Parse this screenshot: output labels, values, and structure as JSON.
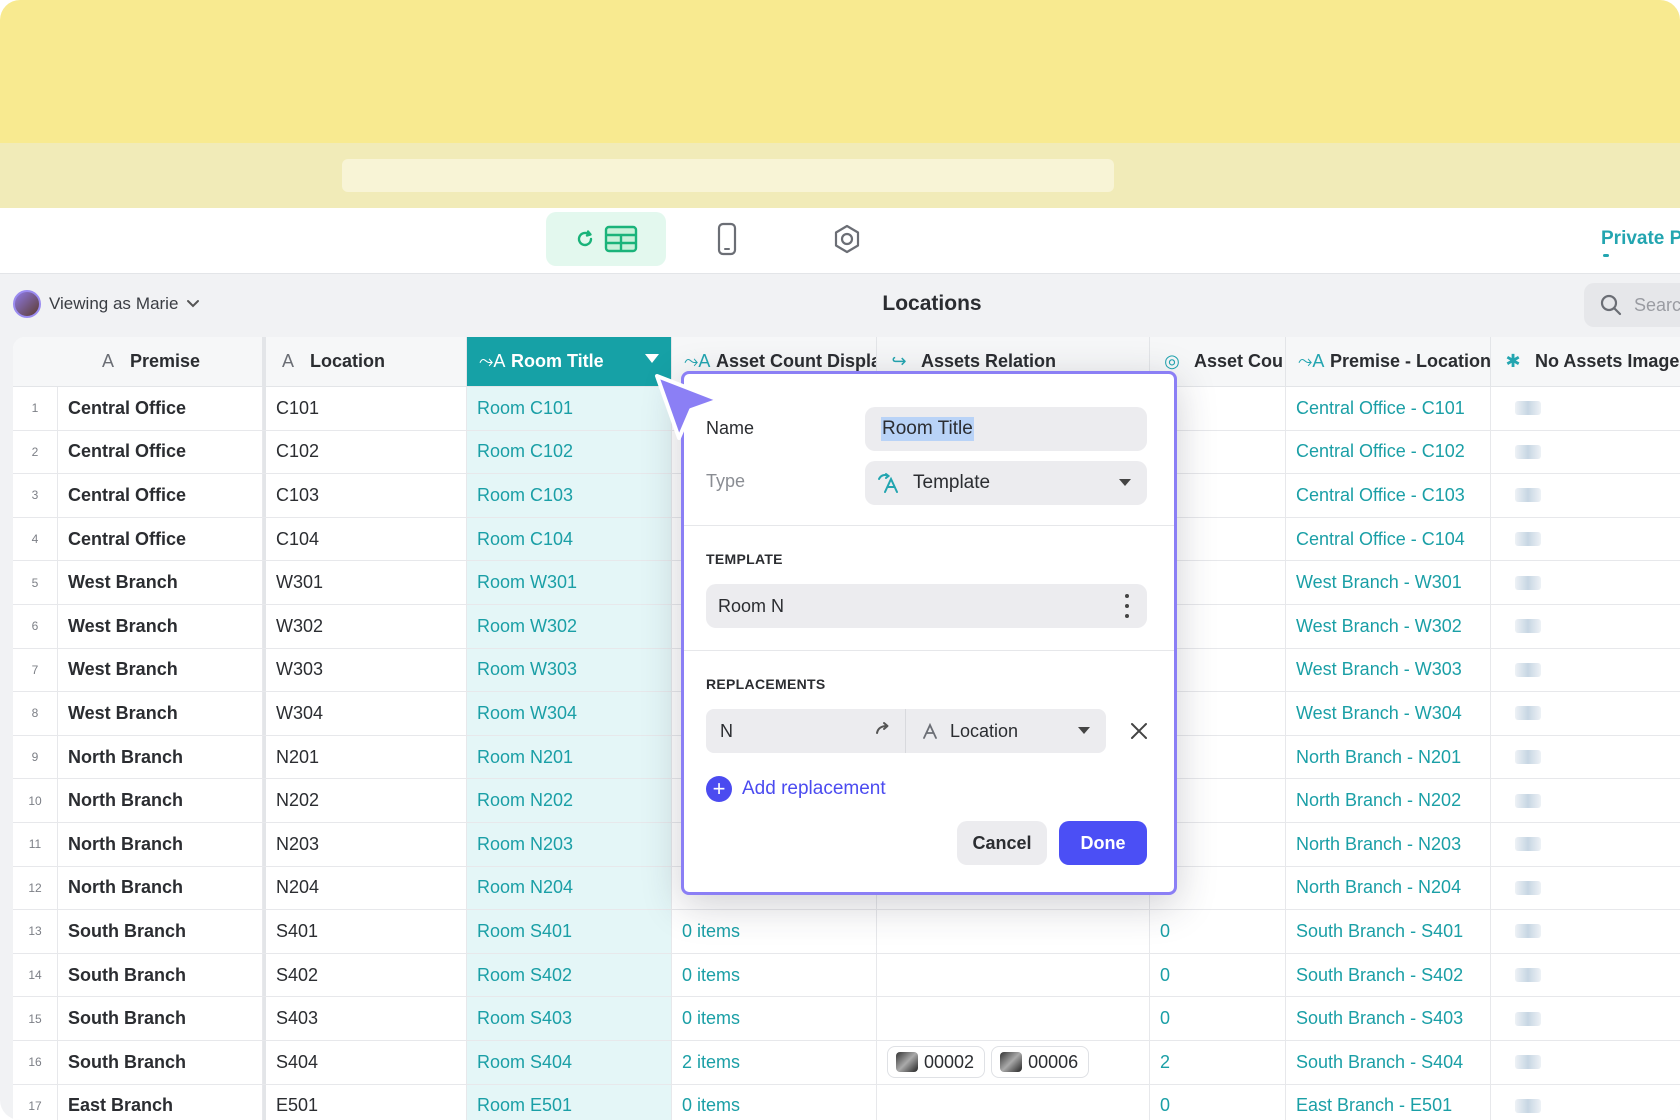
{
  "toolbar": {
    "private_link": "Private P",
    "icons": [
      "data-editor-icon",
      "phone-icon",
      "settings-icon"
    ]
  },
  "viewbar": {
    "viewing_prefix": "Viewing as",
    "viewing_user": "Marie",
    "page_title": "Locations",
    "search_placeholder": "Searc"
  },
  "columns": [
    {
      "label": "Premise",
      "icon": "text-icon"
    },
    {
      "label": "Location",
      "icon": "text-icon"
    },
    {
      "label": "Room Title",
      "icon": "template-icon"
    },
    {
      "label": "Asset Count Displa",
      "icon": "template-icon"
    },
    {
      "label": "Assets Relation",
      "icon": "relation-icon"
    },
    {
      "label": "Asset Cou",
      "icon": "rollup-icon"
    },
    {
      "label": "Premise - Location",
      "icon": "template-icon"
    },
    {
      "label": "No Assets Image",
      "icon": "asterisk-icon"
    }
  ],
  "rows": [
    {
      "n": "1",
      "premise": "Central Office",
      "location": "C101",
      "room": "Room C101",
      "count_display": "",
      "relation": [],
      "count": "",
      "pl": "Central Office - C101"
    },
    {
      "n": "2",
      "premise": "Central Office",
      "location": "C102",
      "room": "Room C102",
      "count_display": "",
      "relation": [],
      "count": "",
      "pl": "Central Office - C102"
    },
    {
      "n": "3",
      "premise": "Central Office",
      "location": "C103",
      "room": "Room C103",
      "count_display": "",
      "relation": [],
      "count": "",
      "pl": "Central Office - C103"
    },
    {
      "n": "4",
      "premise": "Central Office",
      "location": "C104",
      "room": "Room C104",
      "count_display": "",
      "relation": [],
      "count": "",
      "pl": "Central Office - C104"
    },
    {
      "n": "5",
      "premise": "West Branch",
      "location": "W301",
      "room": "Room W301",
      "count_display": "",
      "relation": [],
      "count": "",
      "pl": "West Branch - W301"
    },
    {
      "n": "6",
      "premise": "West Branch",
      "location": "W302",
      "room": "Room W302",
      "count_display": "",
      "relation": [],
      "count": "",
      "pl": "West Branch - W302"
    },
    {
      "n": "7",
      "premise": "West Branch",
      "location": "W303",
      "room": "Room W303",
      "count_display": "",
      "relation": [],
      "count": "",
      "pl": "West Branch - W303"
    },
    {
      "n": "8",
      "premise": "West Branch",
      "location": "W304",
      "room": "Room W304",
      "count_display": "",
      "relation": [],
      "count": "",
      "pl": "West Branch - W304"
    },
    {
      "n": "9",
      "premise": "North Branch",
      "location": "N201",
      "room": "Room N201",
      "count_display": "",
      "relation": [],
      "count": "",
      "pl": "North Branch - N201"
    },
    {
      "n": "10",
      "premise": "North Branch",
      "location": "N202",
      "room": "Room N202",
      "count_display": "",
      "relation": [],
      "count": "",
      "pl": "North Branch - N202"
    },
    {
      "n": "11",
      "premise": "North Branch",
      "location": "N203",
      "room": "Room N203",
      "count_display": "",
      "relation": [],
      "count": "",
      "pl": "North Branch - N203"
    },
    {
      "n": "12",
      "premise": "North Branch",
      "location": "N204",
      "room": "Room N204",
      "count_display": "",
      "relation": [],
      "count": "",
      "pl": "North Branch - N204"
    },
    {
      "n": "13",
      "premise": "South Branch",
      "location": "S401",
      "room": "Room S401",
      "count_display": "0 items",
      "relation": [],
      "count": "0",
      "pl": "South Branch - S401"
    },
    {
      "n": "14",
      "premise": "South Branch",
      "location": "S402",
      "room": "Room S402",
      "count_display": "0 items",
      "relation": [],
      "count": "0",
      "pl": "South Branch - S402"
    },
    {
      "n": "15",
      "premise": "South Branch",
      "location": "S403",
      "room": "Room S403",
      "count_display": "0 items",
      "relation": [],
      "count": "0",
      "pl": "South Branch - S403"
    },
    {
      "n": "16",
      "premise": "South Branch",
      "location": "S404",
      "room": "Room S404",
      "count_display": "2 items",
      "relation": [
        "00002",
        "00006"
      ],
      "count": "2",
      "pl": "South Branch - S404"
    },
    {
      "n": "17",
      "premise": "East Branch",
      "location": "E501",
      "room": "Room E501",
      "count_display": "0 items",
      "relation": [],
      "count": "0",
      "pl": "East Branch - E501"
    }
  ],
  "popup": {
    "name_label": "Name",
    "name_value": "Room Title",
    "type_label": "Type",
    "type_value": "Template",
    "template_section": "TEMPLATE",
    "template_value": "Room N",
    "replacements_section": "REPLACEMENTS",
    "replacement_key": "N",
    "replacement_value": "Location",
    "add_replacement": "Add replacement",
    "cancel": "Cancel",
    "done": "Done"
  },
  "colors": {
    "accent_teal": "#16a1a6",
    "popup_border": "#8b7ff5",
    "primary_button": "#4b4ff5",
    "browser_yellow": "#f8ea90"
  }
}
